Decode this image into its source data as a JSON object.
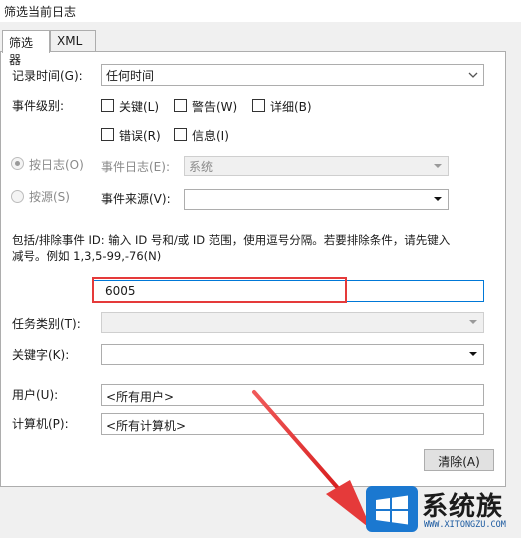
{
  "window": {
    "title": "筛选当前日志"
  },
  "tabs": [
    {
      "label": "筛选器"
    },
    {
      "label": "XML"
    }
  ],
  "form": {
    "logged_label": "记录时间(G):",
    "logged_value": "任何时间",
    "event_level_label": "事件级别:",
    "levels": {
      "critical": "关键(L)",
      "warning": "警告(W)",
      "verbose": "详细(B)",
      "error": "错误(R)",
      "information": "信息(I)"
    },
    "by_log_label": "按日志(O)",
    "by_source_label": "按源(S)",
    "event_logs_label": "事件日志(E):",
    "event_logs_value": "系统",
    "event_sources_label": "事件来源(V):",
    "event_sources_value": "",
    "include_desc_line1": "包括/排除事件 ID: 输入 ID 号和/或 ID 范围，使用逗号分隔。若要排除条件，请先键入",
    "include_desc_line2": "减号。例如 1,3,5-99,-76(N)",
    "event_ids_value": "6005",
    "task_category_label": "任务类别(T):",
    "task_category_value": "",
    "keywords_label": "关键字(K):",
    "keywords_value": "",
    "user_label": "用户(U):",
    "user_value": "<所有用户>",
    "computer_label": "计算机(P):",
    "computer_value": "<所有计算机>",
    "clear_button": "清除(A)"
  },
  "watermark": {
    "brand": "系统族",
    "url": "WWW.XITONGZU.COM"
  },
  "colors": {
    "highlight": "#e53a3a",
    "arrow": "#e53a3a",
    "focus": "#0078d7"
  }
}
